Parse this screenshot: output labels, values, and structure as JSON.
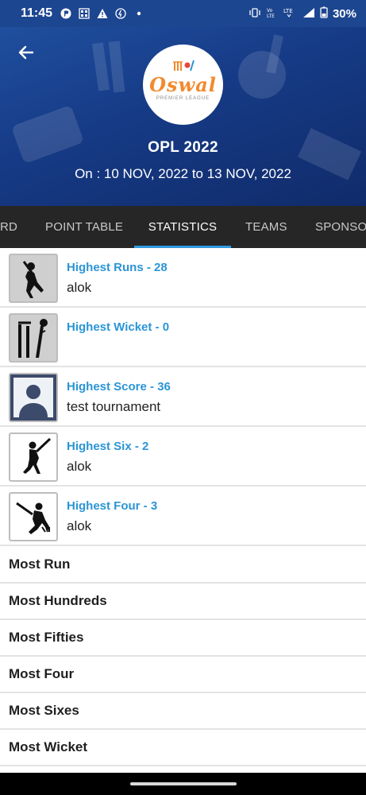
{
  "status_bar": {
    "time": "11:45",
    "battery": "30%",
    "icons": [
      "app-icon",
      "grid-icon",
      "warning-icon",
      "clock-icon",
      "dot-icon",
      "vibrate-icon",
      "volte-icon",
      "lte-icon",
      "signal-icon",
      "battery-icon"
    ]
  },
  "header": {
    "logo_word": "Oswal",
    "logo_sub": "PREMIER LEAGUE",
    "title": "OPL 2022",
    "dates": "On : 10 NOV, 2022 to 13 NOV, 2022"
  },
  "tabs": [
    {
      "label": "RD",
      "active": false
    },
    {
      "label": "POINT TABLE",
      "active": false
    },
    {
      "label": "STATISTICS",
      "active": true
    },
    {
      "label": "TEAMS",
      "active": false
    },
    {
      "label": "SPONSOR",
      "active": false
    }
  ],
  "stats": [
    {
      "title": "Highest Runs - 28",
      "subtitle": "alok",
      "icon": "batsman-icon"
    },
    {
      "title": "Highest Wicket - 0",
      "subtitle": "",
      "icon": "wickets-icon"
    },
    {
      "title": "Highest Score - 36",
      "subtitle": "test tournament",
      "icon": "user-placeholder-icon"
    },
    {
      "title": "Highest Six - 2",
      "subtitle": "alok",
      "icon": "six-hitter-icon"
    },
    {
      "title": "Highest Four - 3",
      "subtitle": "alok",
      "icon": "four-hitter-icon"
    }
  ],
  "most": [
    {
      "label": "Most Run"
    },
    {
      "label": "Most Hundreds"
    },
    {
      "label": "Most Fifties"
    },
    {
      "label": "Most Four"
    },
    {
      "label": "Most Sixes"
    },
    {
      "label": "Most Wicket"
    }
  ],
  "colors": {
    "header_bg": "#163a85",
    "tab_bg": "#262626",
    "tab_indicator": "#2f9ae0",
    "stat_title": "#2b95d6",
    "logo_orange": "#f28a2e"
  }
}
